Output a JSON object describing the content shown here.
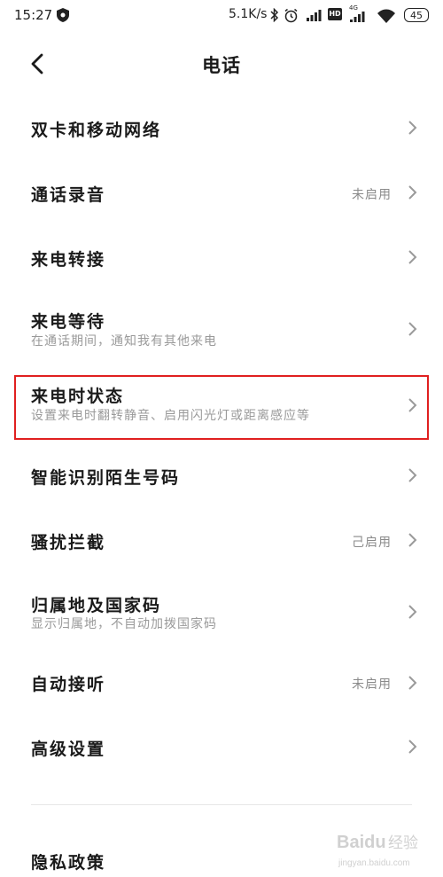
{
  "status_bar": {
    "time": "15:27",
    "speed": "5.1K/s",
    "network_label": "4G",
    "hd_label": "HD",
    "battery": "45"
  },
  "header": {
    "title": "电话",
    "back_icon": "back-arrow-icon"
  },
  "settings": [
    {
      "title": "双卡和移动网络",
      "subtitle": "",
      "value": ""
    },
    {
      "title": "通话录音",
      "subtitle": "",
      "value": "未启用"
    },
    {
      "title": "来电转接",
      "subtitle": "",
      "value": ""
    },
    {
      "title": "来电等待",
      "subtitle": "在通话期间，通知我有其他来电",
      "value": ""
    },
    {
      "title": "来电时状态",
      "subtitle": "设置来电时翻转静音、启用闪光灯或距离感应等",
      "value": ""
    },
    {
      "title": "智能识别陌生号码",
      "subtitle": "",
      "value": ""
    },
    {
      "title": "骚扰拦截",
      "subtitle": "",
      "value": "己启用"
    },
    {
      "title": "归属地及国家码",
      "subtitle": "显示归属地，不自动加拨国家码",
      "value": ""
    },
    {
      "title": "自动接听",
      "subtitle": "",
      "value": "未启用"
    },
    {
      "title": "高级设置",
      "subtitle": "",
      "value": ""
    },
    {
      "title": "隐私政策",
      "subtitle": "",
      "value": ""
    }
  ],
  "highlight_color": "#e02020",
  "watermark": {
    "brand": "Baidu",
    "cn": "经验",
    "url": "jingyan.baidu.com"
  }
}
